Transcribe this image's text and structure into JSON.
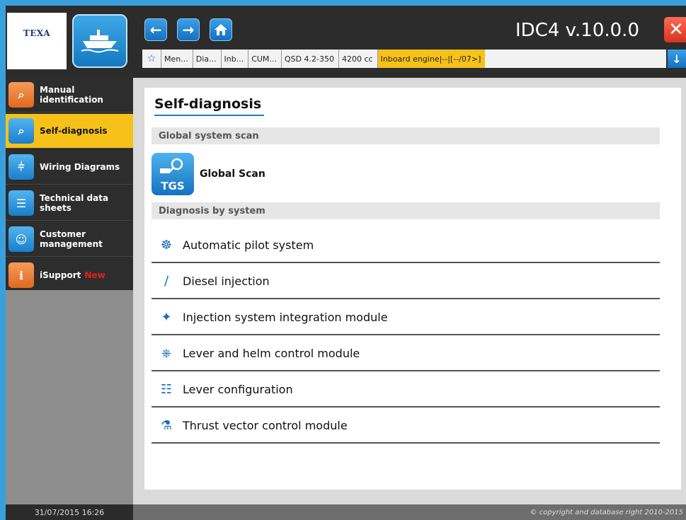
{
  "header": {
    "logo_text": "TEXA",
    "app_title": "IDC4 v.10.0.0",
    "nav": {
      "back_icon": "arrow-left-icon",
      "forward_icon": "arrow-right-icon",
      "home_icon": "home-icon"
    },
    "close_icon": "close-icon"
  },
  "breadcrumb": {
    "items": [
      "Men...",
      "Dia...",
      "Inb...",
      "CUM...",
      "QSD 4.2-350",
      "4200 cc"
    ],
    "active": "Inboard engine|--|[--/07>]"
  },
  "sidebar": {
    "items": [
      {
        "label_line1": "Manual",
        "label_line2": "identification",
        "icon": "manual-id-icon"
      },
      {
        "label_line1": "Self-diagnosis",
        "label_line2": "",
        "icon": "self-diagnosis-icon"
      },
      {
        "label_line1": "Wiring Diagrams",
        "label_line2": "",
        "icon": "wiring-icon"
      },
      {
        "label_line1": "Technical data",
        "label_line2": "sheets",
        "icon": "datasheet-icon"
      },
      {
        "label_line1": "Customer",
        "label_line2": "management",
        "icon": "customer-icon"
      },
      {
        "label_line1": "iSupport",
        "label_line2": "",
        "badge": "New",
        "icon": "isupport-icon"
      }
    ],
    "active_index": 1
  },
  "main": {
    "title": "Self-diagnosis",
    "global_section": "Global system scan",
    "global_scan": {
      "icon_text": "TGS",
      "label": "Global Scan"
    },
    "system_section": "Diagnosis by system",
    "systems": [
      {
        "label": "Automatic pilot system",
        "icon": "steering-wheel-icon"
      },
      {
        "label": "Diesel injection",
        "icon": "injector-icon"
      },
      {
        "label": "Injection system integration module",
        "icon": "injection-module-icon"
      },
      {
        "label": "Lever and helm control module",
        "icon": "lever-helm-icon"
      },
      {
        "label": "Lever configuration",
        "icon": "lever-config-icon"
      },
      {
        "label": "Thrust vector control module",
        "icon": "thrust-vector-icon"
      }
    ]
  },
  "footer": {
    "datetime": "31/07/2015 16:26",
    "copyright": "© copyright and database right 2010-2015"
  }
}
